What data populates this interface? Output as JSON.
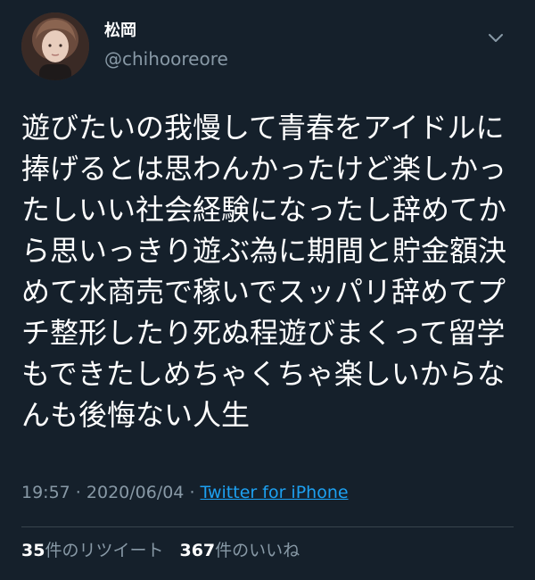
{
  "user": {
    "display_name": "松岡",
    "handle": "@chihooreore"
  },
  "tweet": {
    "lines": [
      "遊びたいの我慢して青春をアイドルに",
      "捧げるとは思わんかったけど楽しかっ",
      "たしいい社会経験になったし辞めてか",
      "ら思いっきり遊ぶ為に期間と貯金額決",
      "めて水商売で稼いでスッパリ辞めてプ",
      "チ整形したり死ぬ程遊びまくって留学",
      "もできたしめちゃくちゃ楽しいからな",
      "んも後悔ない人生"
    ]
  },
  "meta": {
    "time": "19:57",
    "sep1": " · ",
    "date": "2020/06/04",
    "sep2": " · ",
    "source": "Twitter for iPhone"
  },
  "stats": {
    "retweets_count": "35",
    "retweets_label": "件のリツイート",
    "likes_count": "367",
    "likes_label": "件のいいね"
  },
  "icons": {
    "menu": "chevron-down-icon",
    "avatar": "avatar"
  },
  "colors": {
    "background": "#15202b",
    "text": "#ffffff",
    "secondary": "#8899a6",
    "link": "#1da1f2",
    "divider": "#38444d"
  }
}
